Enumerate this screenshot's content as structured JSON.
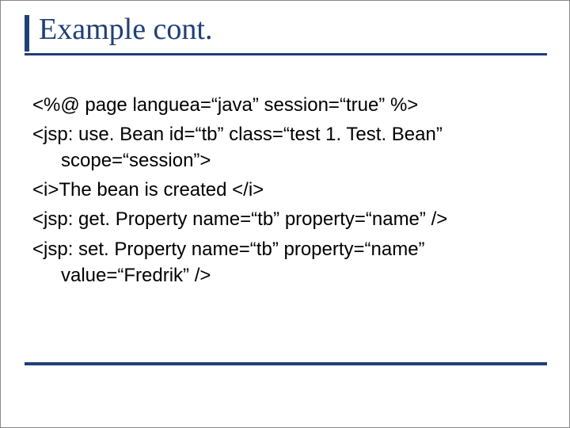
{
  "title": "Example cont.",
  "lines": {
    "l1": "<%@ page languea=“java” session=“true” %>",
    "l2a": "<jsp: use. Bean id=“tb” class=“test 1. Test. Bean”",
    "l2b": "scope=“session”>",
    "l3": "<i>The bean is created </i>",
    "l4": "<jsp: get. Property name=“tb” property=“name” />",
    "l5a": "<jsp: set. Property name=“tb” property=“name”",
    "l5b": "value=“Fredrik” />"
  }
}
